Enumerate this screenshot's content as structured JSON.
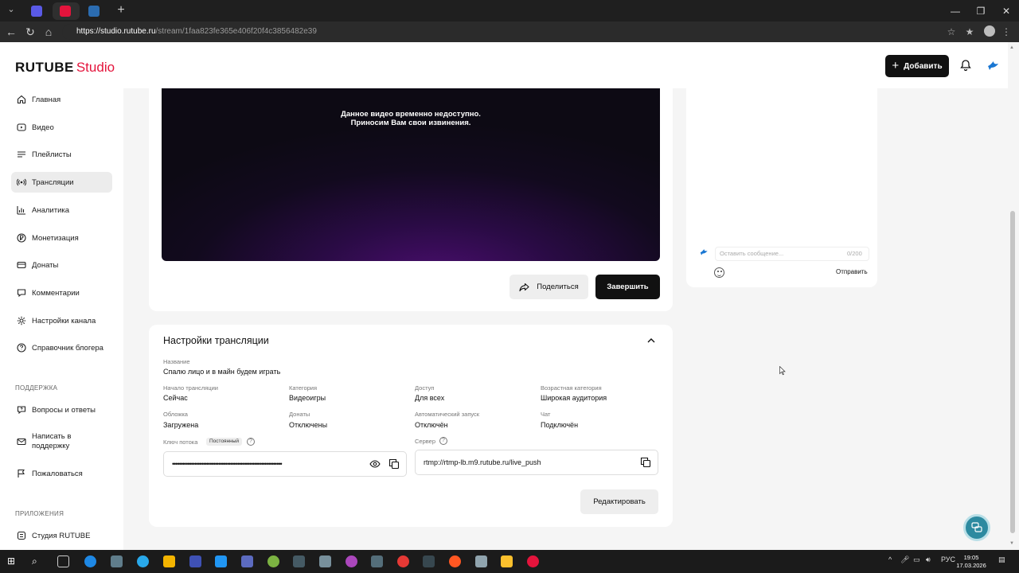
{
  "browser": {
    "url_host": "https://studio.rutube.ru",
    "url_path": "/stream/1faa823fe365e406f20f4c3856482e39"
  },
  "header": {
    "logo_text": "RUTUBE",
    "logo_studio": "Studio",
    "add_label": "Добавить"
  },
  "sidebar": {
    "items": [
      {
        "label": "Главная",
        "icon": "home-icon"
      },
      {
        "label": "Видео",
        "icon": "video-icon"
      },
      {
        "label": "Плейлисты",
        "icon": "playlist-icon"
      },
      {
        "label": "Трансляции",
        "icon": "broadcast-icon"
      },
      {
        "label": "Аналитика",
        "icon": "analytics-icon"
      },
      {
        "label": "Монетизация",
        "icon": "money-icon"
      },
      {
        "label": "Донаты",
        "icon": "donate-icon"
      },
      {
        "label": "Комментарии",
        "icon": "comment-icon"
      },
      {
        "label": "Настройки канала",
        "icon": "settings-icon"
      },
      {
        "label": "Справочник блогера",
        "icon": "help-icon"
      }
    ],
    "support_title": "ПОДДЕРЖКА",
    "support_items": [
      {
        "label": "Вопросы и ответы",
        "icon": "faq-icon"
      },
      {
        "label": "Написать в поддержку",
        "icon": "mail-icon"
      },
      {
        "label": "Пожаловаться",
        "icon": "flag-icon"
      }
    ],
    "apps_title": "ПРИЛОЖЕНИЯ",
    "apps_items": [
      {
        "label": "Студия RUTUBE",
        "icon": "app-icon"
      }
    ]
  },
  "player": {
    "message_line1": "Данное видео временно недоступно.",
    "message_line2": "Приносим Вам свои извинения."
  },
  "actions": {
    "share_label": "Поделиться",
    "finish_label": "Завершить"
  },
  "chat": {
    "placeholder": "Оставить сообщение...",
    "counter": "0/200",
    "send_label": "Отправить"
  },
  "settings": {
    "title": "Настройки трансляции",
    "name_label": "Название",
    "name_value": "Спалю лицо и в майн будем играть",
    "fields": [
      {
        "label": "Начало трансляции",
        "value": "Сейчас"
      },
      {
        "label": "Категория",
        "value": "Видеоигры"
      },
      {
        "label": "Доступ",
        "value": "Для всех"
      },
      {
        "label": "Возрастная категория",
        "value": "Широкая аудитория"
      },
      {
        "label": "Обложка",
        "value": "Загружена"
      },
      {
        "label": "Донаты",
        "value": "Отключены"
      },
      {
        "label": "Автоматический запуск",
        "value": "Отключён"
      },
      {
        "label": "Чат",
        "value": "Подключён"
      }
    ],
    "key_label": "Ключ потока",
    "key_badge": "Постоянный",
    "key_value": "••••••••••••••••••••••••••••••••••••••••••••••••••••••••••••••••",
    "server_label": "Сервер",
    "server_value": "rtmp://rtmp-lb.m9.rutube.ru/live_push",
    "edit_label": "Редактировать"
  },
  "taskbar": {
    "lang": "РУС",
    "time": "19:05",
    "date": "17.03.2026"
  },
  "colors": {
    "brand_red": "#e4143c",
    "dark_button": "#111111",
    "player_purple": "#4a0e6e"
  }
}
